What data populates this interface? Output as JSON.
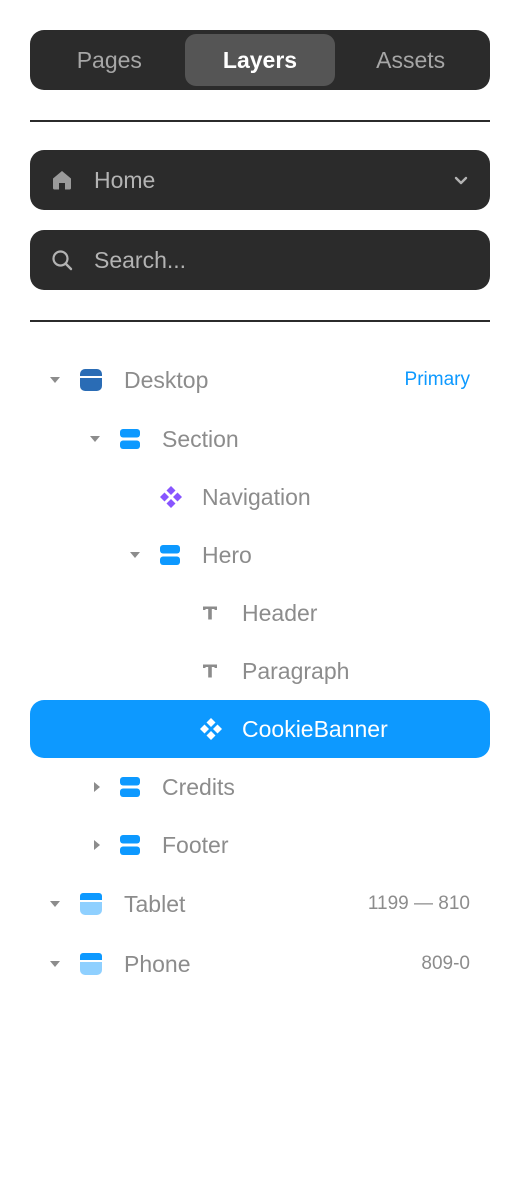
{
  "tabs": [
    {
      "label": "Pages",
      "active": false
    },
    {
      "label": "Layers",
      "active": true
    },
    {
      "label": "Assets",
      "active": false
    }
  ],
  "page_selector": {
    "value": "Home",
    "icon": "home-icon"
  },
  "search": {
    "placeholder": "Search..."
  },
  "layers": [
    {
      "label": "Desktop",
      "meta": "Primary",
      "icon": "breakpoint-icon",
      "caret": "down",
      "depth": 0
    },
    {
      "label": "Section",
      "icon": "stack-icon",
      "caret": "down",
      "depth": 1
    },
    {
      "label": "Navigation",
      "icon": "component-icon",
      "caret": "none",
      "depth": 2
    },
    {
      "label": "Hero",
      "icon": "stack-icon",
      "caret": "down",
      "depth": 2
    },
    {
      "label": "Header",
      "icon": "text-icon",
      "caret": "none",
      "depth": 3
    },
    {
      "label": "Paragraph",
      "icon": "text-icon",
      "caret": "none",
      "depth": 3
    },
    {
      "label": "CookieBanner",
      "icon": "component-instance-icon",
      "caret": "none",
      "depth": 3,
      "selected": true
    },
    {
      "label": "Credits",
      "icon": "stack-icon",
      "caret": "right",
      "depth": 1
    },
    {
      "label": "Footer",
      "icon": "stack-icon",
      "caret": "right",
      "depth": 1
    },
    {
      "label": "Tablet",
      "meta": "1199 — 810",
      "icon": "breakpoint-icon",
      "caret": "down",
      "depth": 0
    },
    {
      "label": "Phone",
      "meta": "809-0",
      "icon": "breakpoint-icon",
      "caret": "down",
      "depth": 0
    }
  ],
  "colors": {
    "panel": "#2b2b2b",
    "accent": "#0d99ff",
    "component": "#8855ff",
    "breakpoint_primary": "#2a6cb5",
    "breakpoint_light": "#8fd0ff"
  }
}
